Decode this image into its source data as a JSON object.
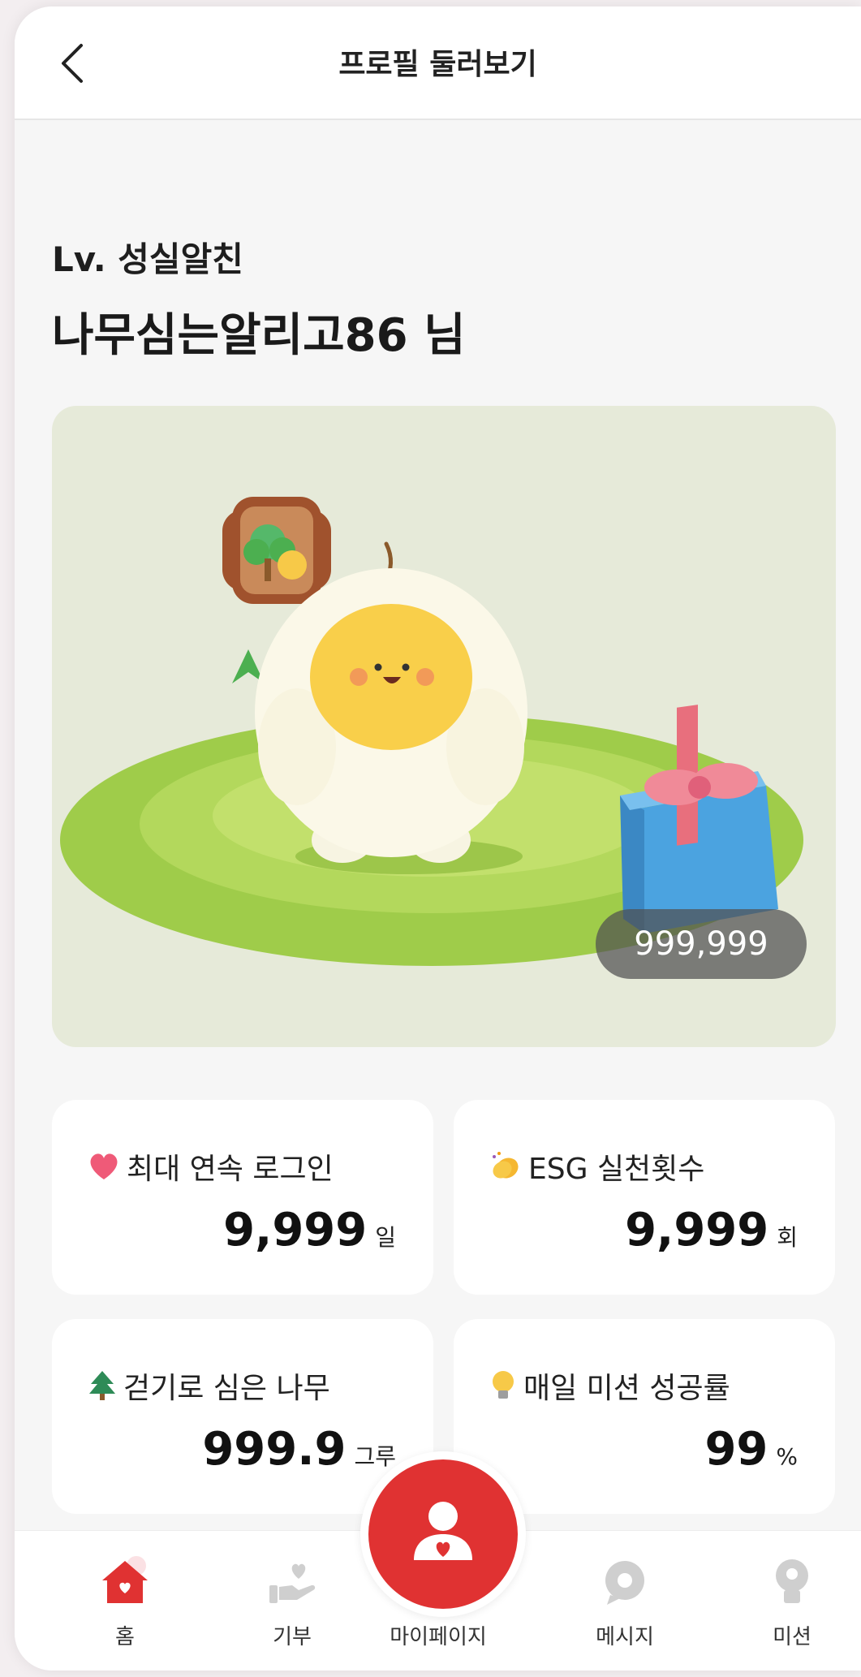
{
  "header": {
    "title": "프로필 둘러보기"
  },
  "profile": {
    "level": "Lv. 성실알친",
    "nickname": "나무심는알리고86 님",
    "points": "999,999"
  },
  "stats": [
    {
      "icon": "heart-icon",
      "label": "최대 연속 로그인",
      "value": "9,999",
      "unit": "일"
    },
    {
      "icon": "clap-icon",
      "label": "ESG 실천횟수",
      "value": "9,999",
      "unit": "회"
    },
    {
      "icon": "tree-icon",
      "label": "걷기로 심은 나무",
      "value": "999.9",
      "unit": "그루"
    },
    {
      "icon": "lightbulb-icon",
      "label": "매일 미션 성공률",
      "value": "99",
      "unit": "%"
    }
  ],
  "nav": [
    {
      "label": "홈",
      "icon": "home-icon",
      "active": true
    },
    {
      "label": "기부",
      "icon": "donate-icon",
      "active": false
    },
    {
      "label": "마이페이지",
      "icon": "mypage-icon",
      "active": false
    },
    {
      "label": "메시지",
      "icon": "message-icon",
      "active": false
    },
    {
      "label": "미션",
      "icon": "mission-icon",
      "active": false
    }
  ],
  "colors": {
    "accent": "#e03232",
    "inactive": "#cfcfcf",
    "scene_bg": "#e6ead9"
  }
}
